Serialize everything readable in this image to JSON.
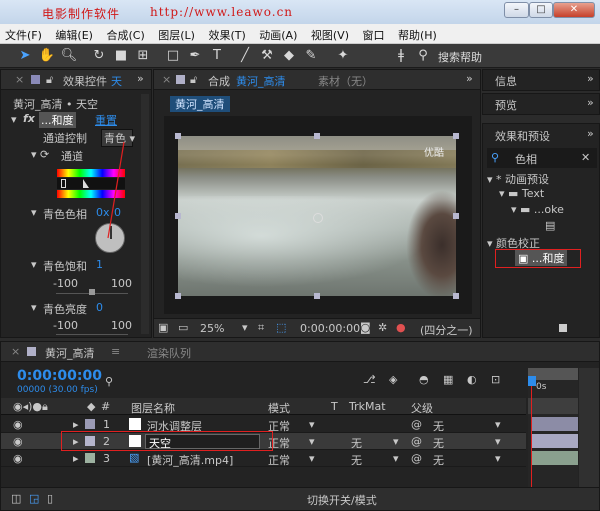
{
  "watermark": {
    "text1": "电影制作软件",
    "text2": "http://www.leawo.cn"
  },
  "window": {
    "min": "–",
    "max": "□",
    "close": "✕"
  },
  "menu": [
    "文件(F)",
    "编辑(E)",
    "合成(C)",
    "图层(L)",
    "效果(T)",
    "动画(A)",
    "视图(V)",
    "窗口",
    "帮助(H)"
  ],
  "toolbar": {
    "search_label": "搜索帮助"
  },
  "effect_controls": {
    "tab": "效果控件",
    "tab_suffix": "天",
    "comp_path": "黄河_高清 • 天空",
    "fx_name": "...和度",
    "reset": "重置",
    "channel_control_label": "通道控制",
    "channel_control_value": "青色",
    "channel_label": "通道",
    "hue_label": "青色色相",
    "hue_value": "0x",
    "hue_value2": "0",
    "sat_label": "青色饱和",
    "sat_value": "1",
    "sat_min": "-100",
    "sat_max": "100",
    "light_label": "青色亮度",
    "light_value": "0",
    "light_min": "-100",
    "light_max": "100"
  },
  "composition": {
    "tab_label": "合成",
    "tab_name": "黄河_高清",
    "source_tab": "素材（无）",
    "breadcrumb": "黄河_高清",
    "video_watermark": "优酷",
    "zoom": "25%",
    "timecode": "0:00:00:00",
    "resolution": "(四分之一)"
  },
  "right_panels": {
    "info": "信息",
    "preview": "预览",
    "effects_presets": "效果和预设",
    "search_value": "色相",
    "tree": [
      "* 动画预设",
      "Text",
      "...oke",
      "颜色校正",
      "...和度"
    ]
  },
  "timeline": {
    "tab": "黄河_高清",
    "render_tab": "渲染队列",
    "timecode": "0:00:00:00",
    "fps": "00000 (30.00 fps)",
    "columns": {
      "layer_name": "图层名称",
      "mode": "模式",
      "t": "T",
      "trkmat": "TrkMat",
      "parent": "父级"
    },
    "layers": [
      {
        "num": "1",
        "name": "河水调整层",
        "mode": "正常",
        "trkmat": "",
        "parent": "无",
        "color": "#9a9ab4"
      },
      {
        "num": "2",
        "name": "天空",
        "mode": "正常",
        "trkmat": "无",
        "parent": "无",
        "color": "#b5b5cc"
      },
      {
        "num": "3",
        "name": "[黄河_高清.mp4]",
        "mode": "正常",
        "trkmat": "无",
        "parent": "无",
        "color": "#9cb1a0"
      }
    ],
    "ruler_label": "0s",
    "status": "切换开关/模式"
  }
}
